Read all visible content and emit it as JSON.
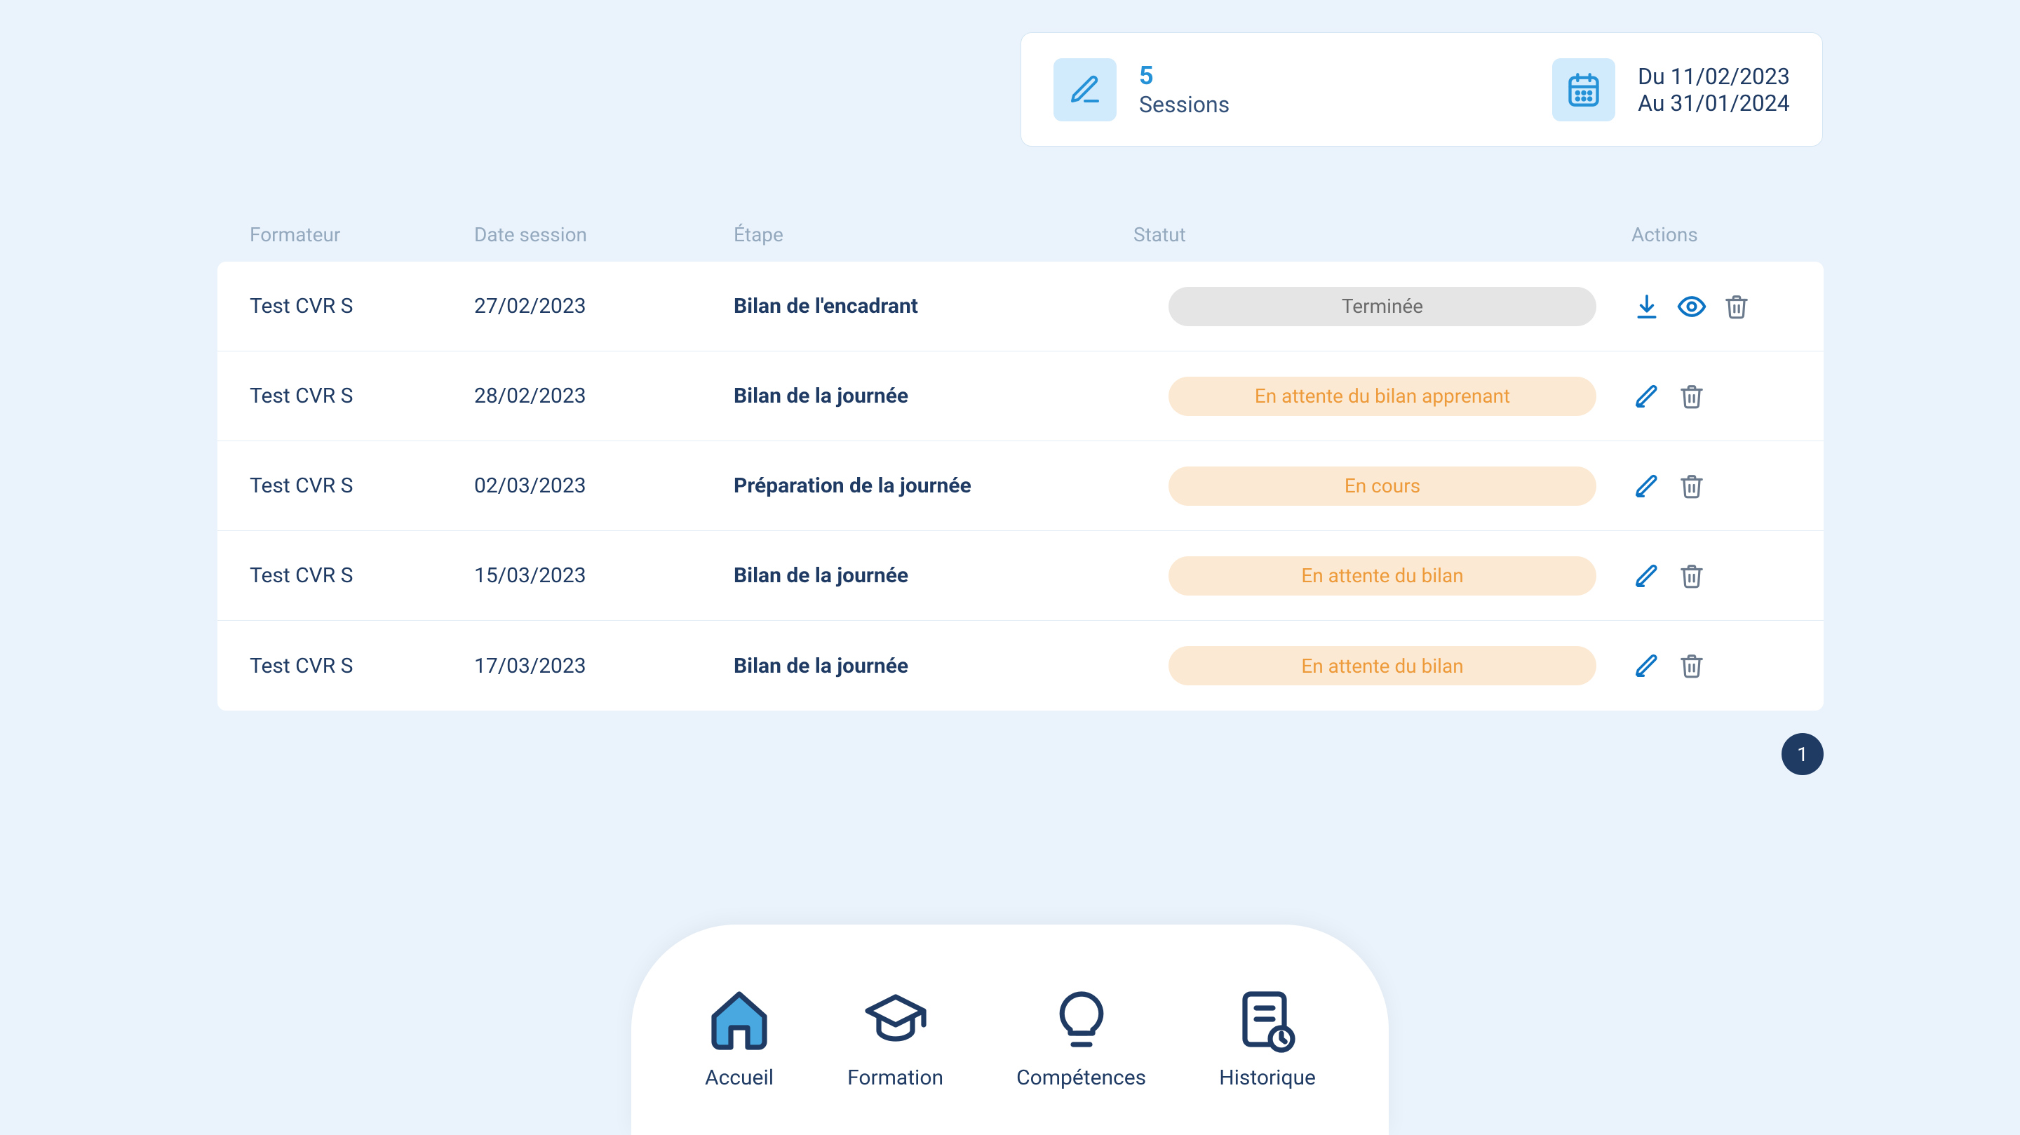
{
  "summary": {
    "count": "5",
    "label": "Sessions",
    "date_from": "Du 11/02/2023",
    "date_to": "Au 31/01/2024"
  },
  "table": {
    "headers": {
      "formateur": "Formateur",
      "date": "Date session",
      "etape": "Étape",
      "statut": "Statut",
      "actions": "Actions"
    },
    "rows": [
      {
        "formateur": "Test CVR S",
        "date": "27/02/2023",
        "etape": "Bilan de l'encadrant",
        "statut": "Terminée",
        "statut_kind": "terminee",
        "actions": [
          "download",
          "view",
          "delete"
        ]
      },
      {
        "formateur": "Test CVR S",
        "date": "28/02/2023",
        "etape": "Bilan de la journée",
        "statut": "En attente du bilan apprenant",
        "statut_kind": "pending",
        "actions": [
          "edit",
          "delete"
        ]
      },
      {
        "formateur": "Test CVR S",
        "date": "02/03/2023",
        "etape": "Préparation de la journée",
        "statut": "En cours",
        "statut_kind": "pending",
        "actions": [
          "edit",
          "delete"
        ]
      },
      {
        "formateur": "Test CVR S",
        "date": "15/03/2023",
        "etape": "Bilan de la journée",
        "statut": "En attente du bilan",
        "statut_kind": "pending",
        "actions": [
          "edit",
          "delete"
        ]
      },
      {
        "formateur": "Test CVR S",
        "date": "17/03/2023",
        "etape": "Bilan de la journée",
        "statut": "En attente du bilan",
        "statut_kind": "pending",
        "actions": [
          "edit",
          "delete"
        ]
      }
    ]
  },
  "pagination": {
    "current": "1"
  },
  "nav": {
    "accueil": "Accueil",
    "formation": "Formation",
    "competences": "Compétences",
    "historique": "Historique"
  }
}
